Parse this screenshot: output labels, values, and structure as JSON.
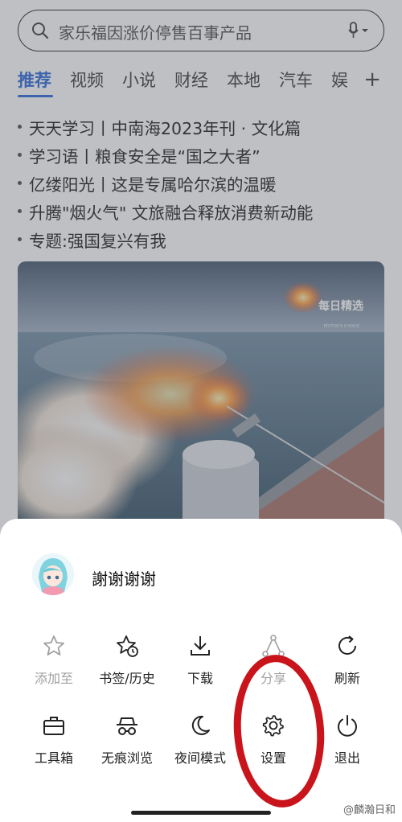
{
  "search": {
    "query": "家乐福因涨价停售百事产品"
  },
  "tabs": [
    "推荐",
    "视频",
    "小说",
    "财经",
    "本地",
    "汽车",
    "娱"
  ],
  "headlines": [
    "天天学习丨中南海2023年刊 · 文化篇",
    "学习语丨粮食安全是“国之大者”",
    "亿缕阳光丨这是专属哈尔滨的温暖",
    "升腾\"烟火气\" 文旅融合释放消费新动能",
    "专题:强国复兴有我"
  ],
  "photo": {
    "badge": "每日精选",
    "badge_small": "EDITOR'S CHOICE"
  },
  "menu": {
    "username": "謝谢谢谢",
    "row1": [
      {
        "label": "添加至",
        "icon": "star-outline-icon",
        "disabled": true
      },
      {
        "label": "书签/历史",
        "icon": "star-clock-icon",
        "disabled": false
      },
      {
        "label": "下载",
        "icon": "download-icon",
        "disabled": false
      },
      {
        "label": "分享",
        "icon": "share-icon",
        "disabled": true
      },
      {
        "label": "刷新",
        "icon": "refresh-icon",
        "disabled": false
      }
    ],
    "row2": [
      {
        "label": "工具箱",
        "icon": "toolbox-icon",
        "disabled": false
      },
      {
        "label": "无痕浏览",
        "icon": "incognito-icon",
        "disabled": false
      },
      {
        "label": "夜间模式",
        "icon": "moon-icon",
        "disabled": false
      },
      {
        "label": "设置",
        "icon": "gear-icon",
        "disabled": false
      },
      {
        "label": "退出",
        "icon": "power-icon",
        "disabled": false
      }
    ]
  },
  "watermark": "@麟瀚日和",
  "colors": {
    "accent": "#1f5fd8",
    "annotation": "#c8141a"
  }
}
